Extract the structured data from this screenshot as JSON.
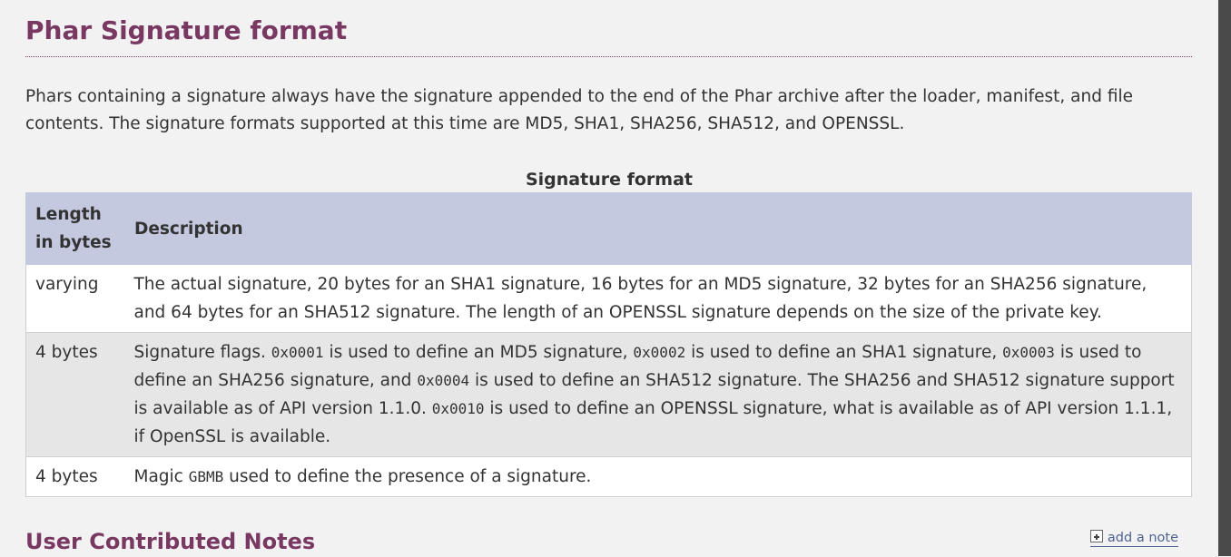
{
  "page": {
    "title": "Phar Signature format",
    "intro": "Phars containing a signature always have the signature appended to the end of the Phar archive after the loader, manifest, and file contents. The signature formats supported at this time are MD5, SHA1, SHA256, SHA512, and OPENSSL."
  },
  "table": {
    "caption": "Signature format",
    "headers": [
      "Length in bytes",
      "Description"
    ],
    "rows": [
      {
        "length": "varying",
        "desc": "The actual signature, 20 bytes for an SHA1 signature, 16 bytes for an MD5 signature, 32 bytes for an SHA256 signature, and 64 bytes for an SHA512 signature. The length of an OPENSSL signature depends on the size of the private key."
      },
      {
        "length": "4 bytes",
        "desc_parts": [
          "Signature flags. ",
          "0x0001",
          " is used to define an MD5 signature, ",
          "0x0002",
          " is used to define an SHA1 signature, ",
          "0x0003",
          " is used to define an SHA256 signature, and ",
          "0x0004",
          " is used to define an SHA512 signature. The SHA256 and SHA512 signature support is available as of API version 1.1.0. ",
          "0x0010",
          " is used to define an OPENSSL signature, what is available as of API version 1.1.1, if OpenSSL is available."
        ]
      },
      {
        "length": "4 bytes",
        "desc_parts": [
          "Magic ",
          "GBMB",
          " used to define the presence of a signature."
        ]
      }
    ]
  },
  "notes": {
    "heading": "User Contributed Notes",
    "add_note_label": "add a note",
    "add_note_icon": "plus-box-icon"
  },
  "colors": {
    "heading": "#793862",
    "table_header_bg": "#c4c9df",
    "link": "#4e6294"
  }
}
